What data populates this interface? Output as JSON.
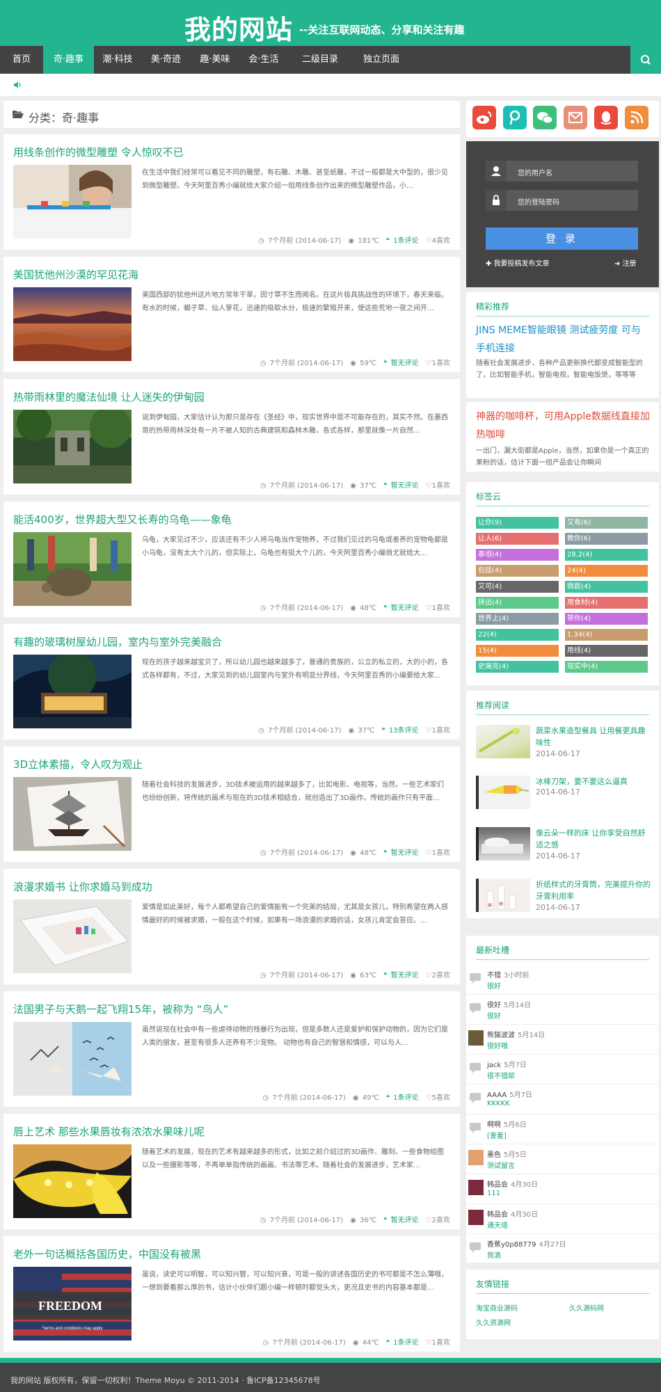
{
  "site": {
    "title": "我的网站",
    "slogan": "--关注互联网动态、分享和关注有趣",
    "brand_color": "#22b58f",
    "dark_color": "#424242"
  },
  "nav": {
    "items": [
      "首页",
      "奇·趣事",
      "潮·科技",
      "美·奇迹",
      "趣·美味",
      "会·生活",
      "二级目录",
      "独立页面"
    ],
    "active": 1
  },
  "category": {
    "title": "分类：奇·趣事"
  },
  "posts": [
    {
      "title": "用线条创作的微型雕塑 令人惊叹不已",
      "excerpt": "在生活中我们经常可以看见不同的雕塑，有石雕、木雕、甚至纸雕，不过一般都是大中型的，很少见到微型雕塑。今天阿里百秀小编就给大家介绍一组用线条创作出来的微型雕塑作品，小...",
      "time": "7个月前 (2014-06-17)",
      "views": "181℃",
      "comments": "1条评论",
      "likes": "4喜欢"
    },
    {
      "title": "美国犹他州沙漠的罕见花海",
      "excerpt": "美国西部的犹他州这片地方常年干旱，因寸草不生而闻名。在这片极具挑战性的环境下，春天来临，有水的时候，蝎子草、仙人掌花，迅速的吸取水分，极速的繁殖开来，使这些荒地一夜之间开...",
      "time": "7个月前 (2014-06-17)",
      "views": "59℃",
      "comments": "暂无评论",
      "likes": "1喜欢"
    },
    {
      "title": "热带雨林里的魔法仙境 让人迷失的伊甸园",
      "excerpt": "说到伊甸园，大家估计认为那只是存在《圣经》中，现实世界中是不可能存在的，其实不然。在墨西哥的热带雨林深处有一片不被人知的古典建筑和森林木雕，各式各样，那里就像一片自然...",
      "time": "7个月前 (2014-06-17)",
      "views": "37℃",
      "comments": "暂无评论",
      "likes": "1喜欢"
    },
    {
      "title": "能活400岁，世界超大型又长寿的乌龟——象龟",
      "excerpt": "乌龟，大家见过不少，应该还有不少人将乌龟当作宠物养，不过我们见过的乌龟或者养的宠物龟都是小乌龟，没有太大个儿的，但实际上，乌龟也有挺大个儿的，今天阿里百秀小编俏尤就给大...",
      "time": "7个月前 (2014-06-17)",
      "views": "48℃",
      "comments": "暂无评论",
      "likes": "1喜欢"
    },
    {
      "title": "有趣的玻璃树屋幼儿园，室内与室外完美融合",
      "excerpt": "现在的孩子越来越宝贝了，所以幼儿园也越来越多了，普通的贵族的，公立的私立的，大的小的，各式各样都有，不过，大家见到的幼儿园室内与室外有明显分界线，今天阿里百秀的小编要给大家...",
      "time": "7个月前 (2014-06-17)",
      "views": "37℃",
      "comments": "13条评论",
      "likes": "1喜欢"
    },
    {
      "title": "3D立体素描，令人叹为观止",
      "excerpt": "随着社会科技的发展进步，3D技术被运用的越来越多了，比如电影、电视等，当然，一些艺术家们也纷纷创新，将传统的画术与现在的3D技术相结合，就创造出了3D画作。传统的画作只有平面...",
      "time": "7个月前 (2014-06-17)",
      "views": "48℃",
      "comments": "暂无评论",
      "likes": "1喜欢"
    },
    {
      "title": "浪漫求婚书 让你求婚马到成功",
      "excerpt": "爱情是如此美好，每个人都希望自己的爱情能有一个完美的结局，尤其是女孩儿，特别希望在两人感情最好的时候被求婚，一般在这个时候，如果有一场浪漫的求婚的话，女孩儿肯定会答应。...",
      "time": "7个月前 (2014-06-17)",
      "views": "63℃",
      "comments": "暂无评论",
      "likes": "2喜欢"
    },
    {
      "title": "法国男子与天鹅一起飞翔15年，被称为 “鸟人”",
      "excerpt": "虽然说现在社会中有一些虐待动物的残暴行为出现，但是多数人还是爱护和保护动物的，因为它们是人类的朋友，甚至有很多人还养有不少宠物。 动物也有自己的智慧和情感，可以与人...",
      "time": "7个月前 (2014-06-17)",
      "views": "49℃",
      "comments": "1条评论",
      "likes": "5喜欢"
    },
    {
      "title": "唇上艺术 那些水果唇妆有浓浓水果味儿呢",
      "excerpt": "随着艺术的发展，现在的艺术有越来越多的形式，比如之前介绍过的3D画作、雕刻、一些食物组图以及一些摄影等等，不再单单指传统的画画、书法等艺术。随着社会的发展进步，艺术家...",
      "time": "7个月前 (2014-06-17)",
      "views": "36℃",
      "comments": "暂无评论",
      "likes": "2喜欢"
    },
    {
      "title": "老外一句话概括各国历史，中国没有被黑",
      "excerpt": "虽说，读史可以明智，可以知兴替，可以知兴衰，可是一般的讲述各国历史的书可都是不怎么薄哦，一想到要看那么厚的书，估计小伙伴们跟小编一样顿时都觉头大，更况且史书的内容基本都是...",
      "time": "7个月前 (2014-06-17)",
      "views": "44℃",
      "comments": "1条评论",
      "likes": "1喜欢"
    }
  ],
  "thumb_texts": {
    "freedom": "FREEDOM",
    "terms": "*terms and conditions may apply"
  },
  "login": {
    "user_placeholder": "您的用户名",
    "pass_placeholder": "您的登陆密码",
    "button": "登 录",
    "submit_link": "我要投稿发布文章",
    "register_link": "注册"
  },
  "featured": {
    "title": "精彩推荐",
    "items": [
      {
        "title": "JINS MEME智能眼镜 测试疲劳度 可与手机连接",
        "desc": "随着社会发展进步，各种产品更新换代都变成智能型的了，比如智能手机，智能电视，智能电饭煲，等等等",
        "color": "#1a8ec7"
      },
      {
        "title": "神器的咖啡杯，可用Apple数据线直接加热咖啡",
        "desc": "一出门，漏大街都是Apple，当然，如果你是一个真正的果粉的话，估计下面一组产品会让你瞬间",
        "color": "#e04b3a"
      }
    ]
  },
  "tags": {
    "title": "标签云",
    "items": [
      {
        "label": "让你(9)",
        "color": "#43c2a0"
      },
      {
        "label": "又有(6)",
        "color": "#8fb5a3"
      },
      {
        "label": "让人(6)",
        "color": "#e66f6f"
      },
      {
        "label": "教你(6)",
        "color": "#8c9ba3"
      },
      {
        "label": "泰坦(4)",
        "color": "#c56fdc"
      },
      {
        "label": "28.2(4)",
        "color": "#43c2a0"
      },
      {
        "label": "包括(4)",
        "color": "#c99c6e"
      },
      {
        "label": "24(4)",
        "color": "#f08c3c"
      },
      {
        "label": "又可(4)",
        "color": "#666666"
      },
      {
        "label": "微距(4)",
        "color": "#43c2a0"
      },
      {
        "label": "拼出(4)",
        "color": "#5bc98a"
      },
      {
        "label": "用食材(4)",
        "color": "#e66f6f"
      },
      {
        "label": "世界上(4)",
        "color": "#8c9ba3"
      },
      {
        "label": "带你(4)",
        "color": "#c56fdc"
      },
      {
        "label": "22(4)",
        "color": "#43c2a0"
      },
      {
        "label": "1.34(4)",
        "color": "#c99c6e"
      },
      {
        "label": "15(4)",
        "color": "#f08c3c"
      },
      {
        "label": "用线(4)",
        "color": "#666666"
      },
      {
        "label": "史端克(4)",
        "color": "#43c2a0"
      },
      {
        "label": "现实中(4)",
        "color": "#5bc98a"
      }
    ]
  },
  "recommended": {
    "title": "推荐阅读",
    "items": [
      {
        "title": "蔬菜水果造型餐具 让用餐更具趣味性",
        "date": "2014-06-17"
      },
      {
        "title": "冰棒刀架，要不要这么逼真",
        "date": "2014-06-17"
      },
      {
        "title": "像云朵一样的床 让你享受自然舒适之感",
        "date": "2014-06-17"
      },
      {
        "title": "折纸样式的牙膏筒，完美提升你的牙膏利用率",
        "date": "2014-06-17"
      }
    ]
  },
  "comments": {
    "title": "最新吐槽",
    "items": [
      {
        "name": "不错",
        "time": "3小时前",
        "text": "很好"
      },
      {
        "name": "很好",
        "time": "5月14日",
        "text": "很好"
      },
      {
        "name": "熊猫波波",
        "time": "5月14日",
        "text": "很好哦"
      },
      {
        "name": "jack",
        "time": "5月7日",
        "text": "很不错耶"
      },
      {
        "name": "AAAA",
        "time": "5月7日",
        "text": "KKKKK"
      },
      {
        "name": "啊啊",
        "time": "5月6日",
        "text": "[害羞]"
      },
      {
        "name": "墨色",
        "time": "5月5日",
        "text": "测试留言"
      },
      {
        "name": "韩品会",
        "time": "4月30日",
        "text": "111"
      },
      {
        "name": "韩品会",
        "time": "4月30日",
        "text": "通天塔"
      },
      {
        "name": "香蕉y0p88779",
        "time": "4月27日",
        "text": "我滴"
      }
    ]
  },
  "links": {
    "title": "友情链接",
    "items": [
      "淘宝商业源码",
      "久久源码网",
      "久久资源网"
    ]
  },
  "footer": {
    "text": "我的网站 版权所有，保留一切权利！Theme Moyu © 2011-2014 · 鲁ICP备12345678号"
  }
}
